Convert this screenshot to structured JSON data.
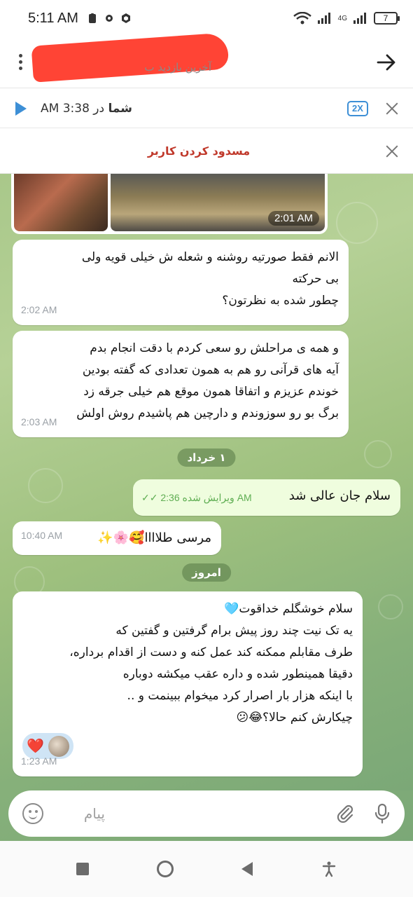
{
  "status_bar": {
    "time": "5:11 AM",
    "battery": "7",
    "network": "4G"
  },
  "header": {
    "last_seen": "آخرین بازدید ب"
  },
  "audio_bar": {
    "sender": "شما",
    "time_text": "در 3:38 AM",
    "speed": "2X"
  },
  "block_bar": {
    "label": "مسدود کردن کاربر"
  },
  "photos": {
    "time": "2:01 AM"
  },
  "messages": [
    {
      "text_lines": [
        "الانم فقط صورتیه روشنه و شعله ش خیلی قویه ولی",
        "بی حرکته",
        "چطور شده به نظرتون؟"
      ],
      "time": "2:02 AM"
    },
    {
      "text_lines": [
        "و همه ی مراحلش رو سعی کردم با دقت انجام بدم",
        "آیه های قرآنی رو هم به همون تعدادی که گفته بودین",
        "خوندم عزیزم و اتفاقا همون موقع هم خیلی جرقه زد",
        "برگ بو رو سوزوندم و دارچین هم پاشیدم روش اولش"
      ],
      "time": "2:03 AM"
    }
  ],
  "date_separator_1": "۱ خرداد",
  "out_message": {
    "text": "سلام جان عالی شد",
    "edited": "ویرایش شده",
    "time": "2:36 AM"
  },
  "thanks_message": {
    "text": "مرسی طلاااا🥰🌸✨",
    "time": "10:40 AM"
  },
  "date_separator_2": "امروز",
  "last_message": {
    "text_lines": [
      "سلام خوشگلم خداقوت🩵",
      "یه تک نیت چند روز پیش برام گرفتین و گفتین که",
      "طرف مقابلم ممکنه کند عمل کنه و دست از اقدام برداره،",
      "دقیقا همینطور شده و داره عقب میکشه دوباره",
      "با اینکه هزار بار اصرار کرد میخوام ببینمت و ..",
      "چیکارش کنم حالا؟😂😕"
    ],
    "reaction": "❤️",
    "time": "1:23 AM"
  },
  "input": {
    "placeholder": "پیام"
  }
}
